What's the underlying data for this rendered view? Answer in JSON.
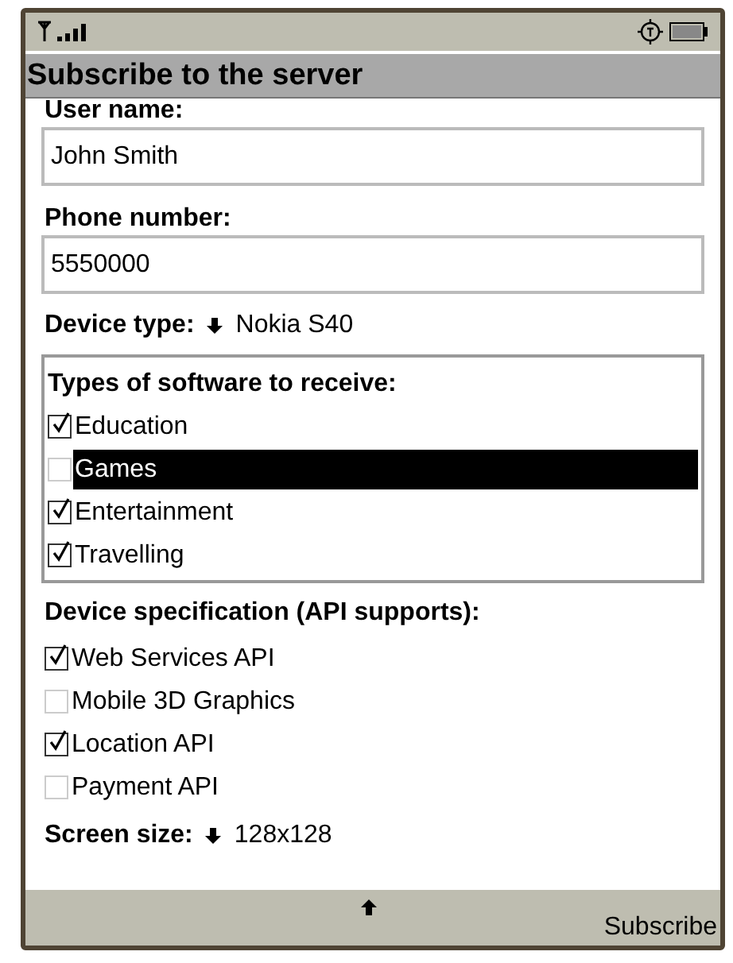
{
  "title": "Subscribe to the server",
  "user_name": {
    "label": "User name:",
    "value": "John Smith"
  },
  "phone_number": {
    "label": "Phone number:",
    "value": "5550000"
  },
  "device_type": {
    "label": "Device type:",
    "value": "Nokia S40"
  },
  "software_types": {
    "label": "Types of software to receive:",
    "items": [
      {
        "label": "Education",
        "checked": true,
        "selected": false
      },
      {
        "label": "Games",
        "checked": false,
        "selected": true
      },
      {
        "label": "Entertainment",
        "checked": true,
        "selected": false
      },
      {
        "label": "Travelling",
        "checked": true,
        "selected": false
      }
    ]
  },
  "device_spec": {
    "label": "Device specification (API supports):",
    "items": [
      {
        "label": "Web Services API",
        "checked": true
      },
      {
        "label": "Mobile 3D Graphics",
        "checked": false
      },
      {
        "label": "Location API",
        "checked": true
      },
      {
        "label": "Payment API",
        "checked": false
      }
    ]
  },
  "screen_size": {
    "label": "Screen size:",
    "value": "128x128"
  },
  "softkeys": {
    "right": "Subscribe"
  }
}
